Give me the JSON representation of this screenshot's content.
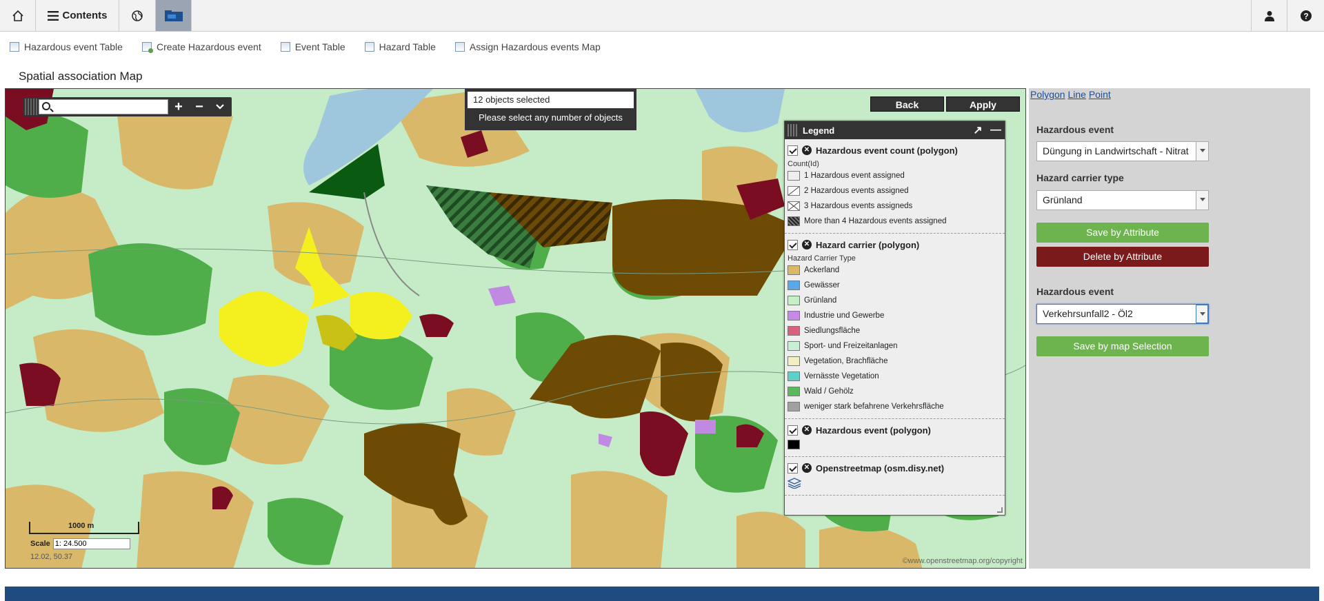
{
  "topbar": {
    "home_icon": "home-icon",
    "contents_label": "Contents",
    "globe_icon": "globe-icon",
    "map_icon": "map-module-icon",
    "user_icon": "user-icon",
    "help_icon": "help-icon"
  },
  "subnav": {
    "items": [
      {
        "label": "Hazardous event Table"
      },
      {
        "label": "Create Hazardous event"
      },
      {
        "label": "Event Table"
      },
      {
        "label": "Hazard Table"
      },
      {
        "label": "Assign Hazardous events Map"
      }
    ]
  },
  "page_title": "Spatial association Map",
  "map": {
    "search_placeholder": "",
    "zoom_in": "+",
    "zoom_out": "−",
    "more": "⌄",
    "selection": {
      "count": "12 objects selected",
      "hint": "Please select any number of objects"
    },
    "back_label": "Back",
    "apply_label": "Apply",
    "scale_bar_label": "1000 m",
    "scale_label": "Scale",
    "scale_value": "1: 24.500",
    "coords": "12.02, 50.37",
    "copyright": "©www.openstreetmap.org/copyright"
  },
  "legend": {
    "title": "Legend",
    "sections": {
      "count": {
        "title": "Hazardous event count (polygon)",
        "sub": "Count(Id)",
        "items": [
          "1 Hazardous event assigned",
          "2 Hazardous events assigned",
          "3 Hazardous events assigneds",
          "More than 4 Hazardous events assigned"
        ]
      },
      "carrier": {
        "title": "Hazard carrier (polygon)",
        "sub": "Hazard Carrier Type",
        "items": [
          {
            "label": "Ackerland",
            "color": "#d9b86a"
          },
          {
            "label": "Gewässer",
            "color": "#5aa9e6"
          },
          {
            "label": "Grünland",
            "color": "#c5efc4"
          },
          {
            "label": "Industrie und Gewerbe",
            "color": "#c48ae6"
          },
          {
            "label": "Siedlungsfläche",
            "color": "#d8607a"
          },
          {
            "label": "Sport- und Freizeitanlagen",
            "color": "#c8f0d6"
          },
          {
            "label": "Vegetation, Brachfläche",
            "color": "#f2efc2"
          },
          {
            "label": "Vernässte Vegetation",
            "color": "#5fd0c8"
          },
          {
            "label": "Wald / Gehölz",
            "color": "#5cb85c"
          },
          {
            "label": "weniger stark befahrene Verkehrsfläche",
            "color": "#a0a0a0"
          }
        ]
      },
      "event": {
        "title": "Hazardous event (polygon)"
      },
      "osm": {
        "title": "Openstreetmap (osm.disy.net)"
      }
    }
  },
  "panel": {
    "tabs": {
      "polygon": "Polygon",
      "line": "Line",
      "point": "Point"
    },
    "hazardous_event_label": "Hazardous event",
    "hazardous_event_value": "Düngung in Landwirtschaft - Nitrat",
    "carrier_type_label": "Hazard carrier type",
    "carrier_type_value": "Grünland",
    "save_attr": "Save by Attribute",
    "delete_attr": "Delete by Attribute",
    "hazardous_event2_label": "Hazardous event",
    "hazardous_event2_value": "Verkehrsunfall2 - Öl2",
    "save_map": "Save by map Selection"
  }
}
